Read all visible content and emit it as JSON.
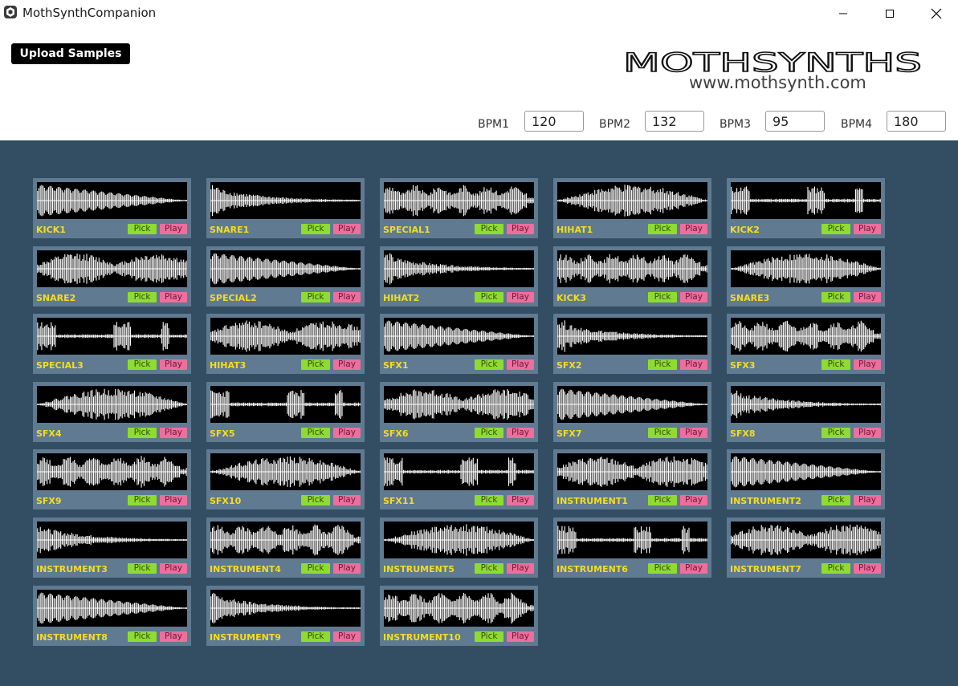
{
  "window": {
    "title": "MothSynthCompanion"
  },
  "header": {
    "upload_label": "Upload Samples",
    "logo_text": "MOTHSYNTHS",
    "website": "www.mothsynth.com",
    "bpm": [
      {
        "label": "BPM1",
        "value": "120"
      },
      {
        "label": "BPM2",
        "value": "132"
      },
      {
        "label": "BPM3",
        "value": "95"
      },
      {
        "label": "BPM4",
        "value": "180"
      }
    ]
  },
  "sample_buttons": {
    "pick_label": "Pick",
    "play_label": "Play"
  },
  "samples": [
    "KICK1",
    "SNARE1",
    "SPECIAL1",
    "HIHAT1",
    "KICK2",
    "SNARE2",
    "SPECIAL2",
    "HIHAT2",
    "KICK3",
    "SNARE3",
    "SPECIAL3",
    "HIHAT3",
    "SFX1",
    "SFX2",
    "SFX3",
    "SFX4",
    "SFX5",
    "SFX6",
    "SFX7",
    "SFX8",
    "SFX9",
    "SFX10",
    "SFX11",
    "INSTRUMENT1",
    "INSTRUMENT2",
    "INSTRUMENT3",
    "INSTRUMENT4",
    "INSTRUMENT5",
    "INSTRUMENT6",
    "INSTRUMENT7",
    "INSTRUMENT8",
    "INSTRUMENT9",
    "INSTRUMENT10"
  ],
  "colors": {
    "background": "#334e63",
    "tile": "#5f7a91",
    "label": "#f5dc23",
    "pick": "#8edc32",
    "play": "#ec6f9d"
  },
  "icons": {
    "app": "app-logo-icon",
    "minimize": "minimize-icon",
    "maximize": "maximize-icon",
    "close": "close-icon"
  }
}
